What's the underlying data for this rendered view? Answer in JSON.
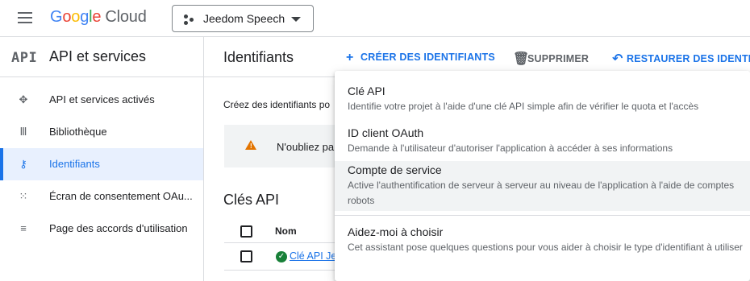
{
  "header": {
    "brand": [
      "G",
      "o",
      "o",
      "g",
      "l",
      "e"
    ],
    "brand_product": "Cloud",
    "project_name": "Jeedom Speech"
  },
  "sidebar": {
    "logo_text": "API",
    "title": "API et services",
    "items": [
      {
        "label": "API et services activés",
        "icon": "apis-icon"
      },
      {
        "label": "Bibliothèque",
        "icon": "library-icon"
      },
      {
        "label": "Identifiants",
        "icon": "key-icon",
        "active": true
      },
      {
        "label": "Écran de consentement OAu...",
        "icon": "consent-icon"
      },
      {
        "label": "Page des accords d'utilisation",
        "icon": "agreements-icon"
      }
    ]
  },
  "toolbar": {
    "page_title": "Identifiants",
    "create_label": "CRÉER DES IDENTIFIANTS",
    "delete_label": "SUPPRIMER",
    "restore_label": "RESTAURER DES IDENTIFI"
  },
  "content": {
    "intro": "Créez des identifiants po",
    "notice": "N'oubliez pa",
    "api_keys_title": "Clés API",
    "table": {
      "col_name": "Nom",
      "rows": [
        {
          "name": "Clé API Je"
        }
      ]
    }
  },
  "menu": {
    "items": [
      {
        "title": "Clé API",
        "desc": "Identifie votre projet à l'aide d'une clé API simple afin de vérifier le quota et l'accès"
      },
      {
        "title": "ID client OAuth",
        "desc": "Demande à l'utilisateur d'autoriser l'application à accéder à ses informations"
      },
      {
        "title": "Compte de service",
        "desc": "Active l'authentification de serveur à serveur au niveau de l'application à l'aide de comptes robots"
      },
      {
        "title": "Aidez-moi à choisir",
        "desc": "Cet assistant pose quelques questions pour vous aider à choisir le type d'identifiant à utiliser"
      }
    ]
  },
  "colors": {
    "accent": "#1a73e8",
    "warning": "#e37400",
    "success": "#188038"
  }
}
